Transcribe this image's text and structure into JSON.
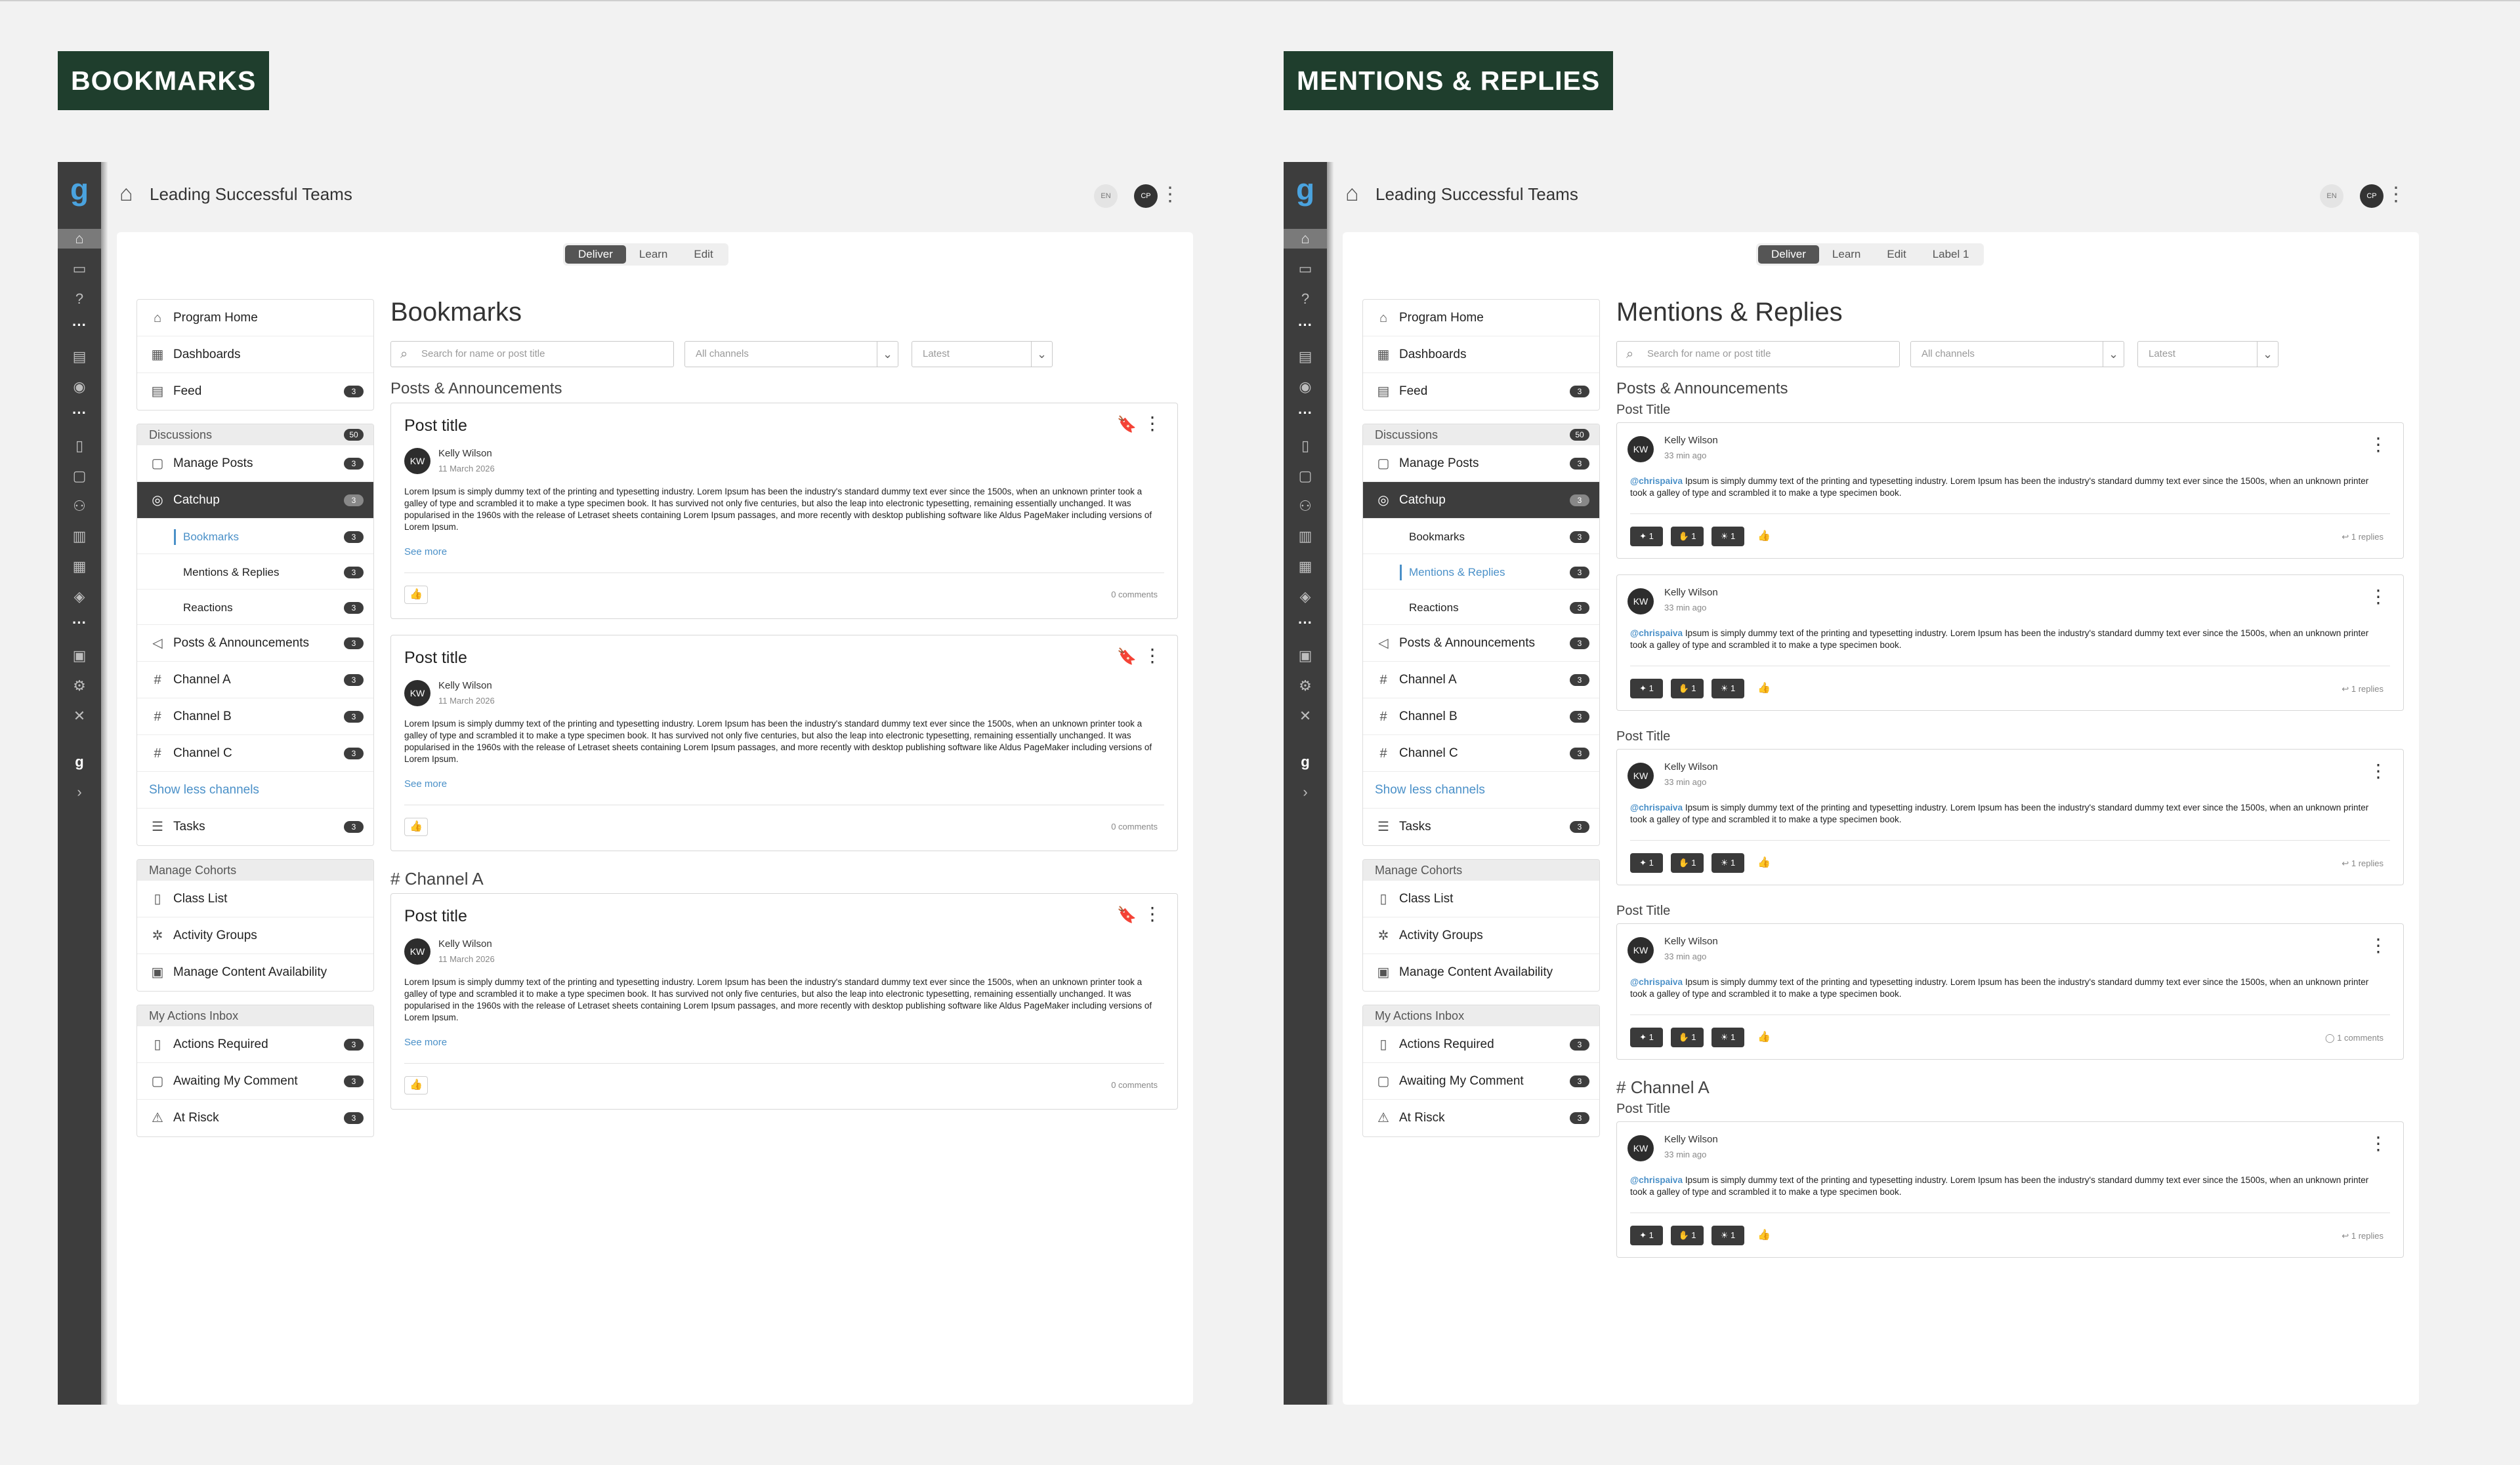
{
  "bookmarks_panel": {
    "header": "BOOKMARKS",
    "breadcrumb": "Leading Successful Teams",
    "lang": "EN",
    "user_initials": "CP",
    "tabs": [
      "Deliver",
      "Learn",
      "Edit"
    ],
    "page_title": "Bookmarks",
    "search_placeholder": "Search for name or post title",
    "channel_filter": "All channels",
    "sort_filter": "Latest",
    "section1": "Posts & Announcements",
    "section2": "Channel A",
    "posts": [
      {
        "title": "Post title",
        "author": "Kelly Wilson",
        "date": "11 March 2026",
        "initials": "KW",
        "see_more": "See more",
        "comments": "0 comments"
      },
      {
        "title": "Post title",
        "author": "Kelly Wilson",
        "date": "11 March 2026",
        "initials": "KW",
        "see_more": "See more",
        "comments": "0 comments"
      },
      {
        "title": "Post title",
        "author": "Kelly Wilson",
        "date": "11 March 2026",
        "initials": "KW",
        "see_more": "See more",
        "comments": "0 comments"
      }
    ]
  },
  "mentions_panel": {
    "header": "MENTIONS & REPLIES",
    "breadcrumb": "Leading Successful Teams",
    "lang": "EN",
    "user_initials": "CP",
    "tabs": [
      "Deliver",
      "Learn",
      "Edit",
      "Label 1"
    ],
    "page_title": "Mentions & Replies",
    "search_placeholder": "Search for name or post title",
    "channel_filter": "All channels",
    "sort_filter": "Latest",
    "section1": "Posts & Announcements",
    "post_label": "Post Title",
    "section2": "Channel A",
    "items": [
      {
        "author": "Kelly Wilson",
        "time": "33 min ago",
        "initials": "KW",
        "footer": "1 replies",
        "reactions": [
          "1",
          "1",
          "1"
        ]
      },
      {
        "author": "Kelly Wilson",
        "time": "33 min ago",
        "initials": "KW",
        "footer": "1 replies",
        "reactions": [
          "1",
          "1",
          "1"
        ]
      },
      {
        "author": "Kelly Wilson",
        "time": "33 min ago",
        "initials": "KW",
        "footer": "1 replies",
        "reactions": [
          "1",
          "1",
          "1"
        ]
      },
      {
        "author": "Kelly Wilson",
        "time": "33 min ago",
        "initials": "KW",
        "footer": "1 comments",
        "reactions": [
          "1",
          "1",
          "1"
        ]
      },
      {
        "author": "Kelly Wilson",
        "time": "33 min ago",
        "initials": "KW",
        "footer": "1 replies",
        "reactions": [
          "1",
          "1",
          "1"
        ]
      }
    ]
  },
  "lorem": "Lorem Ipsum is simply dummy text of the printing and typesetting industry. Lorem Ipsum has been the industry's standard dummy text ever since the 1500s, when an unknown printer took a galley of type and scrambled it to make a type specimen book. It has survived not only five centuries, but also the leap into electronic typesetting, remaining essentially unchanged. It was popularised in the 1960s with the release of Letraset sheets containing Lorem Ipsum passages, and more recently with desktop publishing software like Aldus PageMaker including versions of Lorem Ipsum.",
  "mention_handle": "@chrispaiva",
  "mention_text": " Ipsum is simply dummy text of the printing and typesetting industry. Lorem Ipsum has been the industry's standard dummy text ever since the 1500s, when an unknown printer took a galley of type and scrambled it to make a type specimen book.",
  "sidebar": {
    "top": [
      {
        "label": "Program Home"
      },
      {
        "label": "Dashboards"
      },
      {
        "label": "Feed",
        "badge": "3"
      }
    ],
    "discussions": {
      "label": "Discussions",
      "badge": "50"
    },
    "manage_posts": {
      "label": "Manage Posts",
      "badge": "3"
    },
    "catchup": {
      "label": "Catchup",
      "badge": "3"
    },
    "catchup_sub": [
      {
        "label": "Bookmarks",
        "badge": "3"
      },
      {
        "label": "Mentions & Replies",
        "badge": "3"
      },
      {
        "label": "Reactions",
        "badge": "3"
      }
    ],
    "channels": [
      {
        "label": "Posts & Announcements",
        "badge": "3"
      },
      {
        "label": "Channel A",
        "badge": "3"
      },
      {
        "label": "Channel B",
        "badge": "3"
      },
      {
        "label": "Channel C",
        "badge": "3"
      }
    ],
    "show_less": "Show less channels",
    "tasks": {
      "label": "Tasks",
      "badge": "3"
    },
    "cohorts": {
      "label": "Manage Cohorts",
      "items": [
        {
          "label": "Class List"
        },
        {
          "label": "Activity Groups"
        },
        {
          "label": "Manage Content Availability"
        }
      ]
    },
    "inbox": {
      "label": "My Actions Inbox",
      "items": [
        {
          "label": "Actions Required",
          "badge": "3"
        },
        {
          "label": "Awaiting My Comment",
          "badge": "3"
        },
        {
          "label": "At Risck",
          "badge": "3"
        }
      ]
    }
  },
  "icons": {
    "home": "home-icon",
    "rail_logo": "g-logo-icon"
  },
  "colors": {
    "title_bg": "#1f3e2d",
    "rail": "#3d3d3d",
    "accent": "#4a90c8"
  }
}
